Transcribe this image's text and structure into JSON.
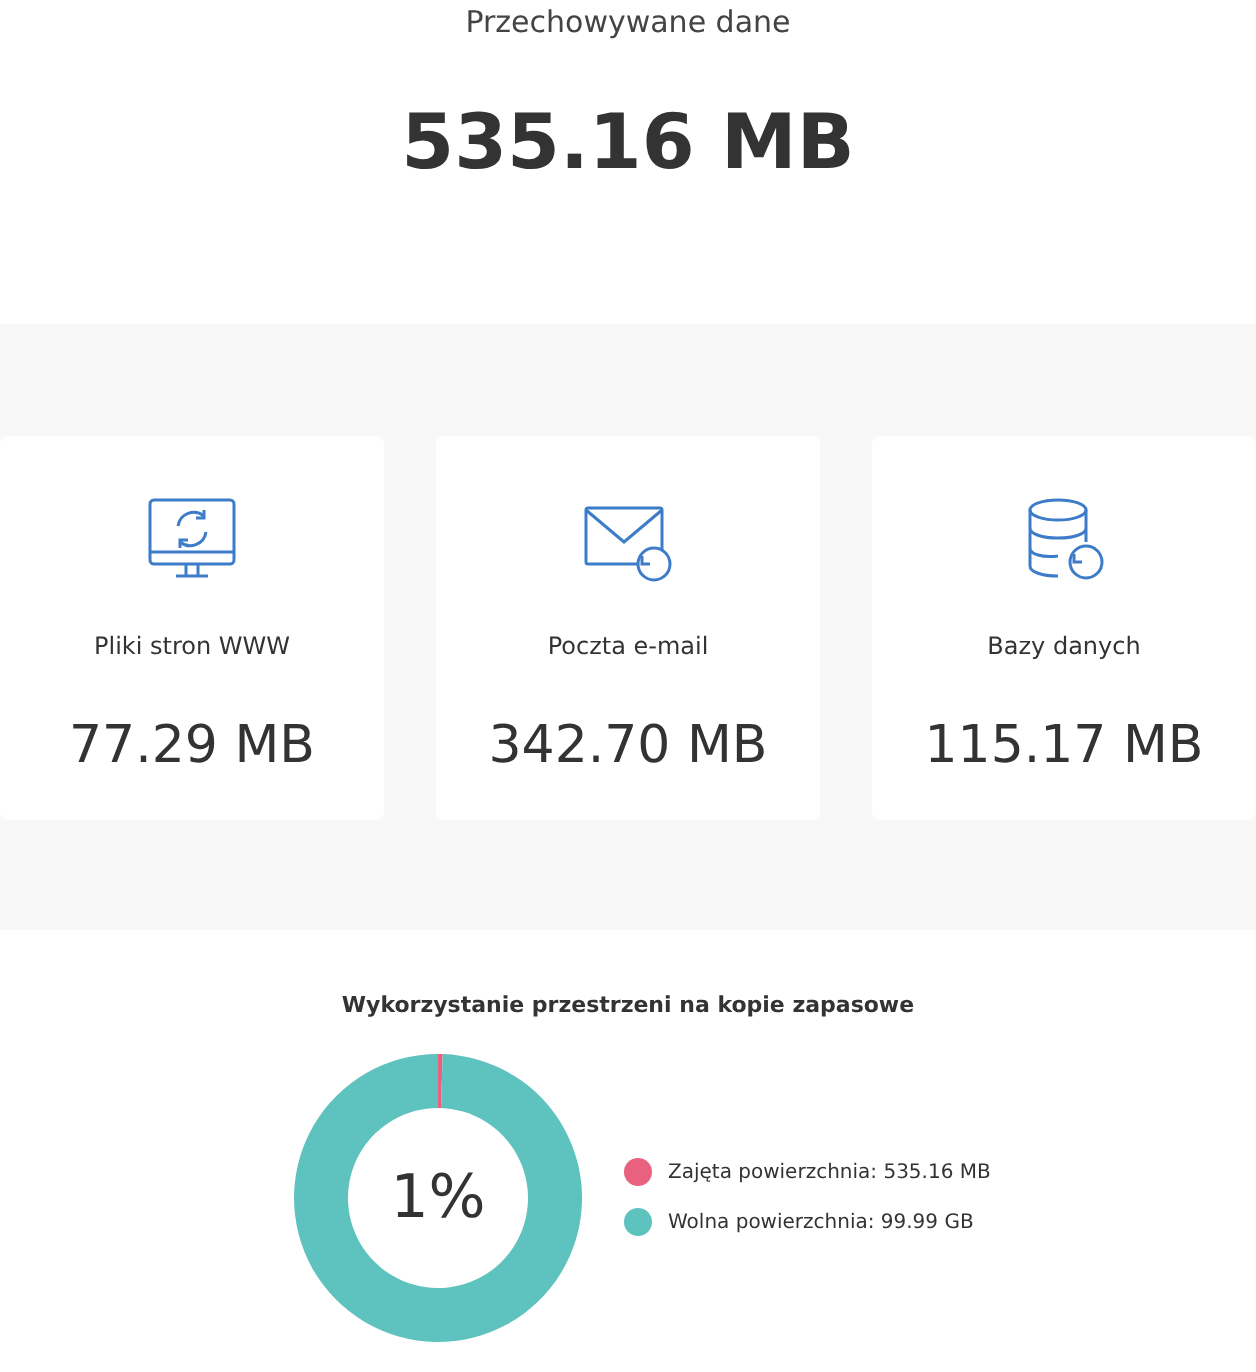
{
  "summary": {
    "title": "Przechowywane dane",
    "total": "535.16 MB"
  },
  "cards": [
    {
      "kind": "website",
      "label": "Pliki stron WWW",
      "value": "77.29 MB"
    },
    {
      "kind": "email",
      "label": "Poczta e-mail",
      "value": "342.70 MB"
    },
    {
      "kind": "database",
      "label": "Bazy danych",
      "value": "115.17 MB"
    }
  ],
  "backup": {
    "title": "Wykorzystanie przestrzeni na kopie zapasowe",
    "center": "1%",
    "legend": [
      {
        "label": "Zajęta powierzchnia: 535.16 MB",
        "color": "#e8617f"
      },
      {
        "label": "Wolna powierzchnia: 99.99 GB",
        "color": "#5ec2bf"
      }
    ],
    "chart_data": {
      "type": "donut",
      "series": [
        {
          "values": [
            0.52,
            99.48
          ]
        }
      ]
    }
  }
}
